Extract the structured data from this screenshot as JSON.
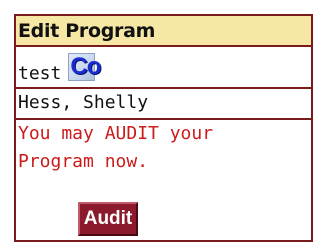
{
  "panel": {
    "title": "Edit Program"
  },
  "program": {
    "name": "test",
    "icon": "co-icon",
    "icon_label": "Co"
  },
  "user": {
    "name": "Hess, Shelly"
  },
  "message": {
    "line1": "You may AUDIT your",
    "line2": "Program now."
  },
  "audit_button": {
    "label": "Audit"
  },
  "colors": {
    "title_background": "#f6e7a4",
    "border": "#7a1a1a",
    "message_text": "#cc1b1b",
    "button_background": "#8b1a2c"
  }
}
